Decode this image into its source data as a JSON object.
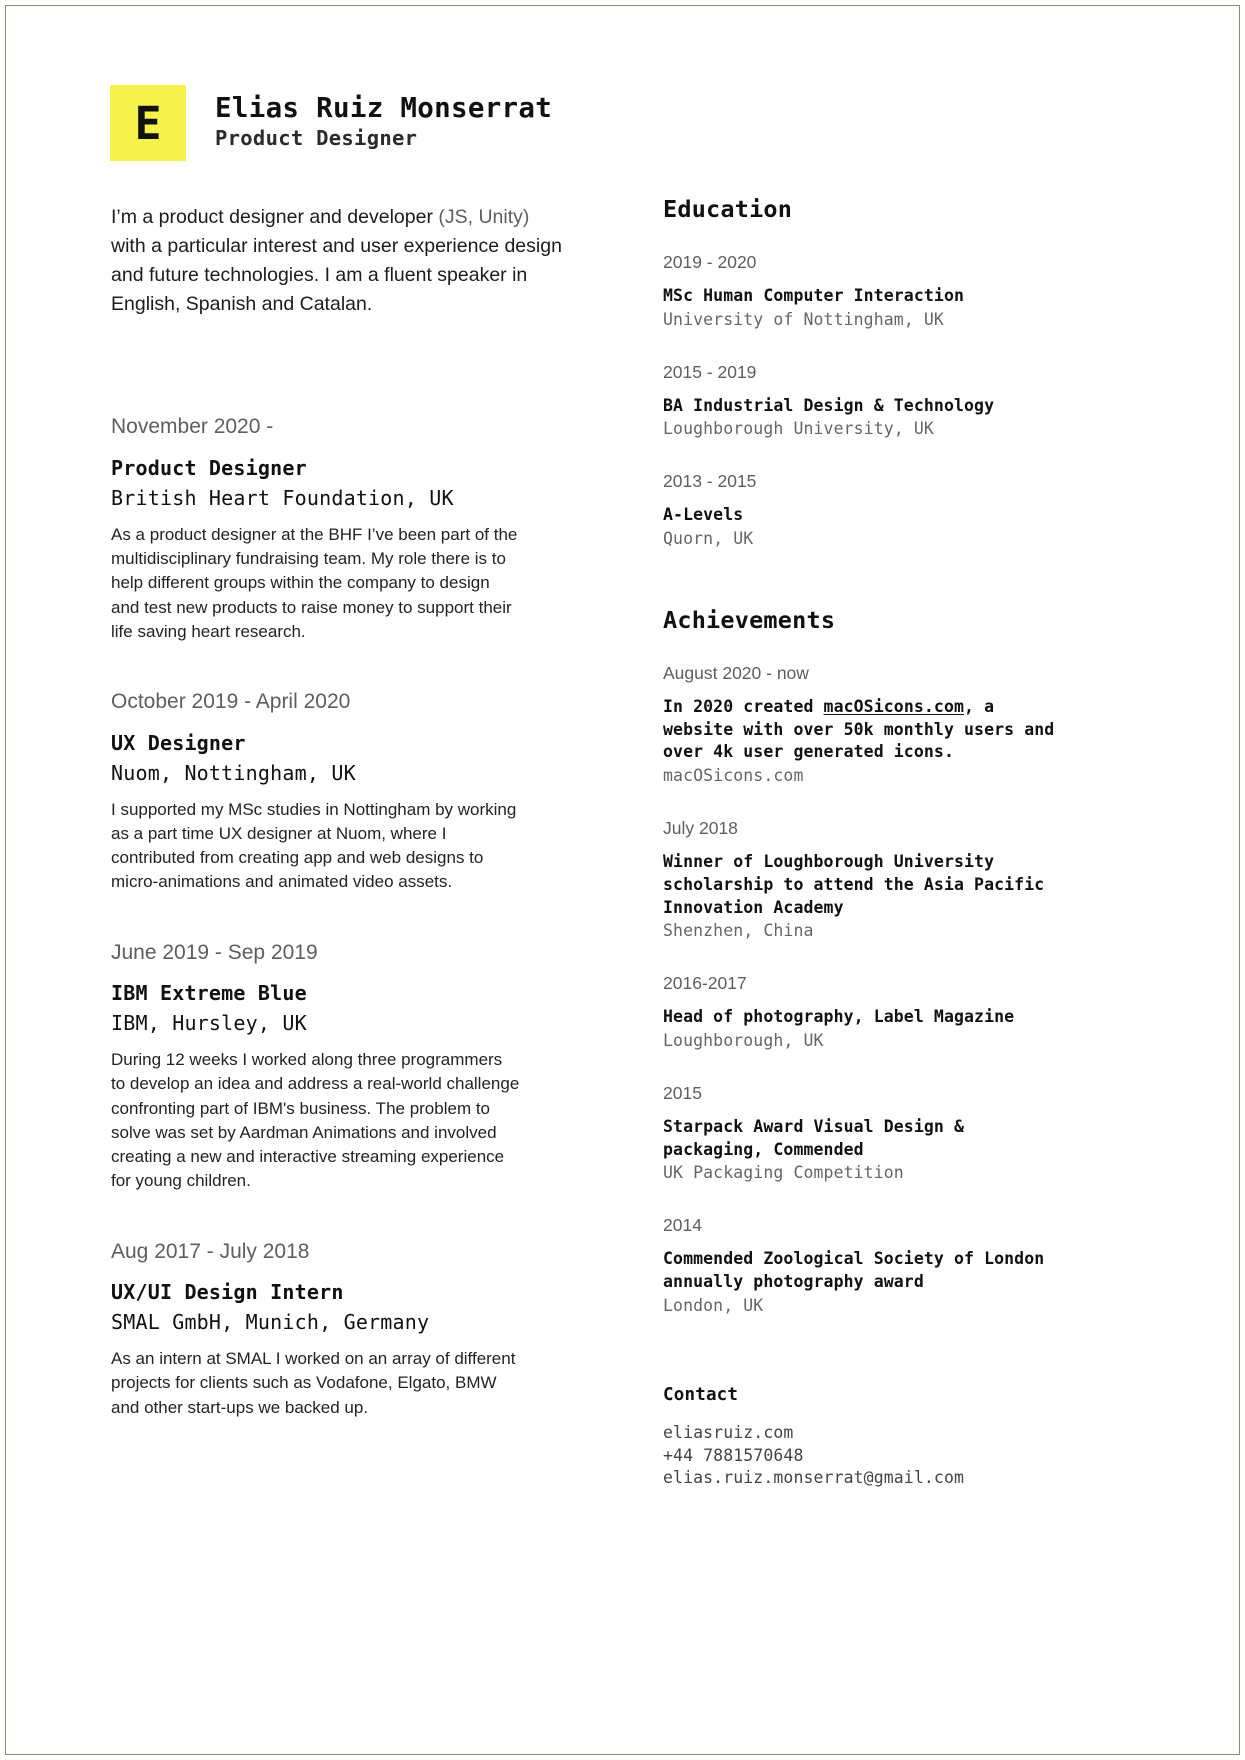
{
  "header": {
    "logo_letter": "E",
    "logo_color": "#F5F24B",
    "name": "Elias Ruiz Monserrat",
    "role": "Product Designer"
  },
  "intro": {
    "part1": "I’m a product designer and  developer ",
    "part2": "(JS, Unity)",
    "part3": " with a particular interest and user experience design and future technologies. I am a fluent speaker in English, Spanish and Catalan."
  },
  "experience": [
    {
      "date": "November 2020 -",
      "title": "Product Designer",
      "company": "British Heart Foundation, UK",
      "description": "As a product designer at the BHF I’ve been part of the multidisciplinary fundraising team. My role there is to help different groups within the company to design and test new products to raise money to support their life saving heart research."
    },
    {
      "date": "October 2019 - April 2020",
      "title": "UX Designer",
      "company": "Nuom, Nottingham, UK",
      "description": "I supported my MSc studies in Nottingham by working as a part time UX designer at Nuom, where I contributed from creating app and web designs to micro-animations and animated video assets."
    },
    {
      "date": "June 2019 - Sep 2019",
      "title": "IBM Extreme Blue",
      "company": "IBM, Hursley, UK",
      "description": "During 12 weeks I worked along three programmers to develop an idea and address a real-world challenge confronting part of IBM's business. The problem to solve was set by Aardman Animations and involved creating a new and interactive streaming experience for young children."
    },
    {
      "date": "Aug 2017 - July 2018",
      "title": "UX/UI Design Intern",
      "company": "SMAL GmbH, Munich, Germany",
      "description": "As an intern at SMAL I worked on an array of different projects for clients such as Vodafone, Elgato, BMW and other start-ups we backed up."
    }
  ],
  "education": {
    "heading": "Education",
    "entries": [
      {
        "date": "2019 - 2020",
        "title": "MSc Human Computer Interaction",
        "sub": "University of Nottingham, UK"
      },
      {
        "date": "2015 - 2019",
        "title": "BA Industrial Design & Technology",
        "sub": "Loughborough University, UK"
      },
      {
        "date": "2013 - 2015",
        "title": "A-Levels",
        "sub": "Quorn, UK"
      }
    ]
  },
  "achievements": {
    "heading": "Achievements",
    "entries": [
      {
        "date": "August 2020 - now",
        "title_pre": "In 2020 created ",
        "title_link": "macOSicons.com",
        "title_post": ", a website with over 50k monthly users and over 4k user generated icons.",
        "sub": "macOSicons.com"
      },
      {
        "date": "July 2018",
        "title": "Winner of Loughborough University scholarship to attend the Asia Pacific Innovation Academy",
        "sub": "Shenzhen, China"
      },
      {
        "date": "2016-2017",
        "title": "Head of photography, Label Magazine",
        "sub": "Loughborough, UK"
      },
      {
        "date": "2015",
        "title": "Starpack Award Visual Design & packaging, Commended",
        "sub": "UK Packaging Competition"
      },
      {
        "date": "2014",
        "title": "Commended Zoological Society of London annually photography award",
        "sub": "London, UK"
      }
    ]
  },
  "contact": {
    "heading": "Contact",
    "website": "eliasruiz.com",
    "phone": "+44 7881570648",
    "email": "elias.ruiz.monserrat@gmail.com"
  }
}
